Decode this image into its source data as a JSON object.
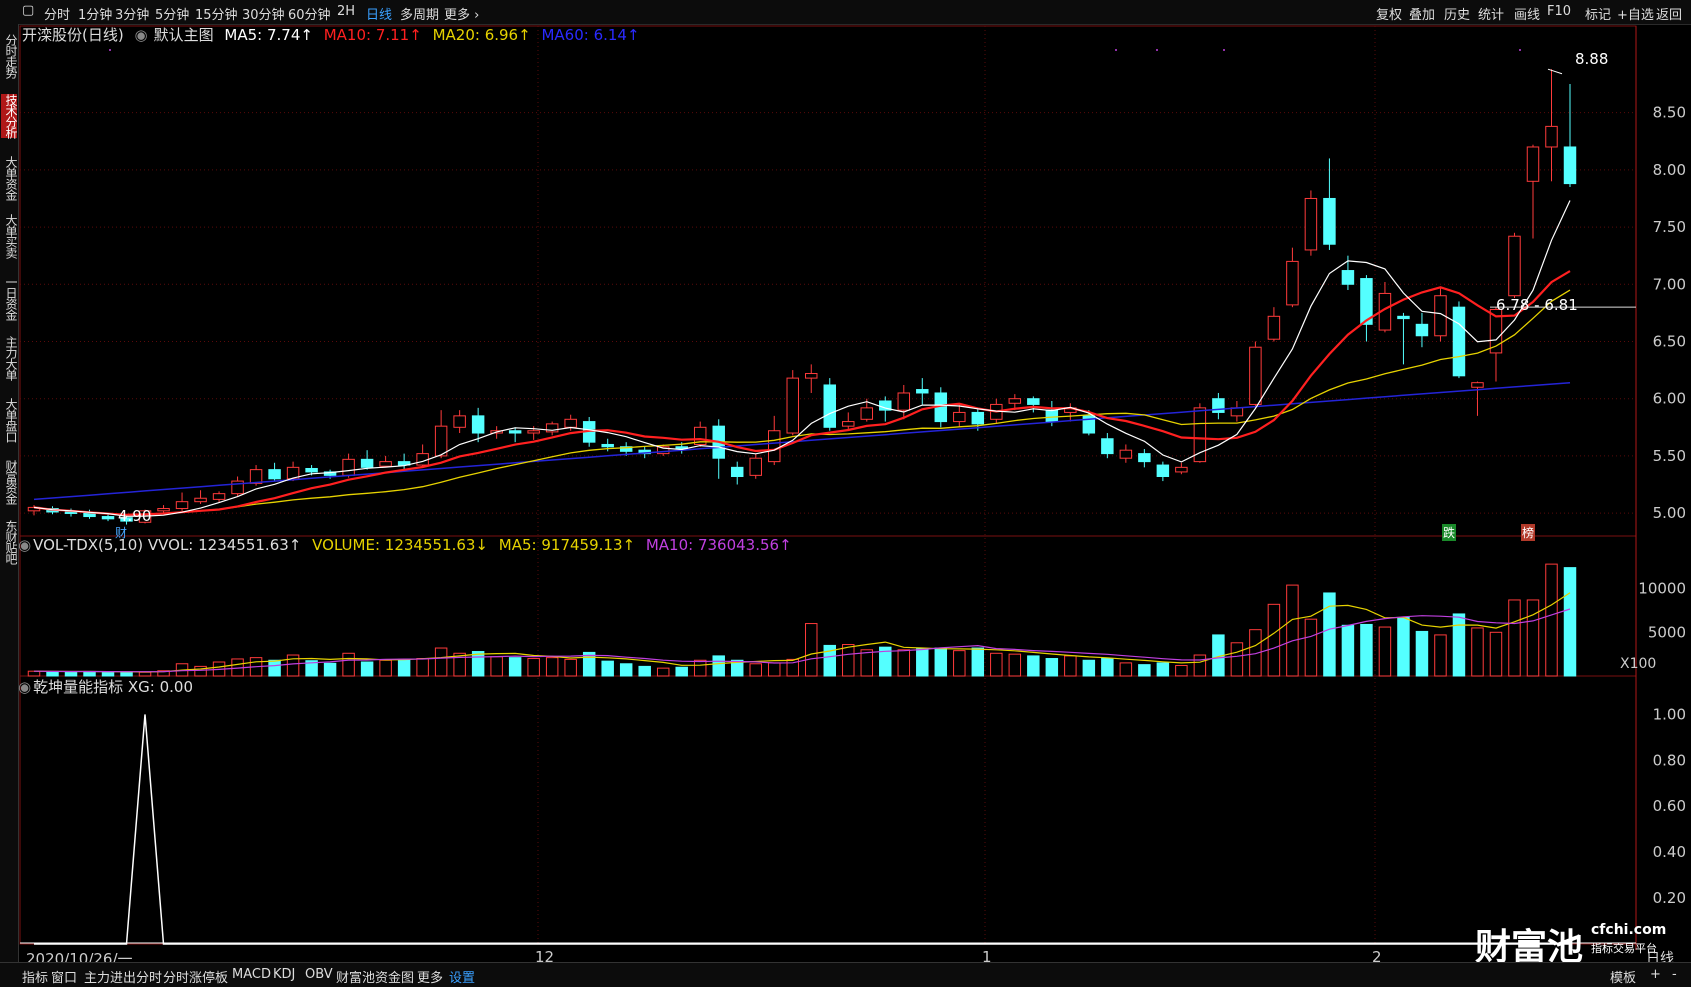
{
  "toolbar": {
    "periods": [
      "分时",
      "1分钟",
      "3分钟",
      "5分钟",
      "15分钟",
      "30分钟",
      "60分钟",
      "2H",
      "日线",
      "多周期",
      "更多"
    ],
    "active_period": "日线",
    "right_items": [
      "复权",
      "叠加",
      "历史",
      "统计",
      "画线",
      "F10",
      "标记",
      "+自选",
      "返回"
    ]
  },
  "left_nav": [
    "分时走势",
    "技术分析",
    "大单资金",
    "大单买卖",
    "一日资金",
    "主力大单",
    "大单盘口",
    "财富资金",
    "东财贴吧"
  ],
  "left_nav_active": "技术分析",
  "main_panel": {
    "stock_name": "开滦股份(日线)",
    "main_chart": "默认主图",
    "ma5": "MA5: 7.74↑",
    "ma10": "MA10: 7.11↑",
    "ma20": "MA20: 6.96↑",
    "ma60": "MA60: 6.14↑",
    "high_label": "8.88",
    "low_label": "4.90",
    "range_label": "6.78 - 6.81",
    "marker_cai": "财",
    "marker_die": "跌",
    "marker_bang": "榜"
  },
  "vol_panel": {
    "title": "VOL-TDX(5,10) VVOL: 1234551.63↑",
    "volume": "VOLUME: 1234551.63↓",
    "ma5": "MA5: 917459.13↑",
    "ma10": "MA10: 736043.56↑",
    "unit": "X100"
  },
  "ind_panel": {
    "title": "乾坤量能指标 XG: 0.00"
  },
  "x_labels": {
    "start": "2020/10/26/一",
    "m12": "12",
    "m1": "1",
    "m2": "2"
  },
  "bottom_tabs": [
    "指标",
    "窗口",
    "主力进出分时",
    "分时涨停板",
    "MACD",
    "KDJ",
    "OBV",
    "财富池资金图",
    "更多",
    "设置"
  ],
  "bottom_tabs_active": "设置",
  "bottom_right": [
    "模板",
    "+",
    "-"
  ],
  "bottom_right_label": "日线",
  "brand": {
    "name": "财富池",
    "site": "cfchi.com",
    "tagline": "指标交易平台"
  },
  "colors": {
    "up": "#ff3b3b",
    "down": "#54ffff",
    "ma5": "#ffffff",
    "ma10": "#ff2020",
    "ma20": "#e6d200",
    "ma60": "#2424d8",
    "vol_ma10": "#c040e0",
    "accent": "#3aa0ff"
  },
  "chart_data": [
    {
      "type": "candlestick",
      "title": "开滦股份(日线)",
      "ylim": [
        4.8,
        9.1
      ],
      "y_ticks": [
        5.0,
        5.5,
        6.0,
        6.5,
        7.0,
        7.5,
        8.0,
        8.5
      ],
      "x_labels": [
        "2020/10/26/一",
        "12",
        "1",
        "2"
      ],
      "candles": [
        [
          5.02,
          5.05,
          4.98,
          5.07
        ],
        [
          5.04,
          5.01,
          4.99,
          5.06
        ],
        [
          5.01,
          5.0,
          4.97,
          5.04
        ],
        [
          5.0,
          4.97,
          4.95,
          5.03
        ],
        [
          4.97,
          4.95,
          4.93,
          5.0
        ],
        [
          4.96,
          4.93,
          4.9,
          4.98
        ],
        [
          4.92,
          5.02,
          4.91,
          5.03
        ],
        [
          5.02,
          5.04,
          5.0,
          5.07
        ],
        [
          5.04,
          5.1,
          5.02,
          5.18
        ],
        [
          5.1,
          5.13,
          5.08,
          5.2
        ],
        [
          5.12,
          5.17,
          5.09,
          5.19
        ],
        [
          5.17,
          5.28,
          5.15,
          5.32
        ],
        [
          5.26,
          5.38,
          5.24,
          5.42
        ],
        [
          5.38,
          5.3,
          5.28,
          5.44
        ],
        [
          5.3,
          5.4,
          5.28,
          5.45
        ],
        [
          5.39,
          5.36,
          5.33,
          5.42
        ],
        [
          5.36,
          5.33,
          5.3,
          5.38
        ],
        [
          5.33,
          5.47,
          5.31,
          5.52
        ],
        [
          5.47,
          5.4,
          5.38,
          5.55
        ],
        [
          5.41,
          5.45,
          5.4,
          5.5
        ],
        [
          5.45,
          5.42,
          5.38,
          5.52
        ],
        [
          5.42,
          5.52,
          5.4,
          5.6
        ],
        [
          5.5,
          5.76,
          5.48,
          5.9
        ],
        [
          5.75,
          5.85,
          5.7,
          5.9
        ],
        [
          5.85,
          5.7,
          5.62,
          5.92
        ],
        [
          5.7,
          5.72,
          5.65,
          5.76
        ],
        [
          5.72,
          5.7,
          5.62,
          5.75
        ],
        [
          5.7,
          5.72,
          5.64,
          5.76
        ],
        [
          5.71,
          5.78,
          5.68,
          5.8
        ],
        [
          5.75,
          5.82,
          5.72,
          5.86
        ],
        [
          5.8,
          5.62,
          5.58,
          5.84
        ],
        [
          5.6,
          5.58,
          5.54,
          5.65
        ],
        [
          5.58,
          5.54,
          5.5,
          5.62
        ],
        [
          5.55,
          5.52,
          5.48,
          5.58
        ],
        [
          5.52,
          5.58,
          5.5,
          5.6
        ],
        [
          5.58,
          5.56,
          5.52,
          5.62
        ],
        [
          5.6,
          5.75,
          5.58,
          5.8
        ],
        [
          5.76,
          5.48,
          5.3,
          5.82
        ],
        [
          5.4,
          5.32,
          5.25,
          5.45
        ],
        [
          5.33,
          5.48,
          5.3,
          5.52
        ],
        [
          5.45,
          5.72,
          5.42,
          5.85
        ],
        [
          5.7,
          6.18,
          5.68,
          6.25
        ],
        [
          6.18,
          6.22,
          6.05,
          6.3
        ],
        [
          6.12,
          5.75,
          5.72,
          6.18
        ],
        [
          5.76,
          5.8,
          5.72,
          5.88
        ],
        [
          5.82,
          5.92,
          5.8,
          6.0
        ],
        [
          5.98,
          5.9,
          5.8,
          6.02
        ],
        [
          5.9,
          6.05,
          5.82,
          6.12
        ],
        [
          6.08,
          6.05,
          5.95,
          6.18
        ],
        [
          6.05,
          5.8,
          5.75,
          6.1
        ],
        [
          5.8,
          5.88,
          5.75,
          5.95
        ],
        [
          5.88,
          5.78,
          5.72,
          5.92
        ],
        [
          5.82,
          5.95,
          5.78,
          6.0
        ],
        [
          5.96,
          6.0,
          5.9,
          6.04
        ],
        [
          6.0,
          5.95,
          5.88,
          6.02
        ],
        [
          5.9,
          5.8,
          5.76,
          5.98
        ],
        [
          5.88,
          5.92,
          5.8,
          5.96
        ],
        [
          5.85,
          5.7,
          5.68,
          5.9
        ],
        [
          5.65,
          5.52,
          5.48,
          5.7
        ],
        [
          5.48,
          5.55,
          5.44,
          5.6
        ],
        [
          5.52,
          5.45,
          5.4,
          5.56
        ],
        [
          5.42,
          5.32,
          5.28,
          5.45
        ],
        [
          5.36,
          5.4,
          5.34,
          5.44
        ],
        [
          5.45,
          5.92,
          5.44,
          5.96
        ],
        [
          6.0,
          5.88,
          5.82,
          6.05
        ],
        [
          5.85,
          5.92,
          5.8,
          5.98
        ],
        [
          5.95,
          6.45,
          5.92,
          6.5
        ],
        [
          6.52,
          6.72,
          6.5,
          6.8
        ],
        [
          6.82,
          7.2,
          6.8,
          7.32
        ],
        [
          7.3,
          7.75,
          7.25,
          7.82
        ],
        [
          7.75,
          7.35,
          7.3,
          8.1
        ],
        [
          7.12,
          7.0,
          6.95,
          7.25
        ],
        [
          7.05,
          6.65,
          6.5,
          7.08
        ],
        [
          6.6,
          6.92,
          6.58,
          7.02
        ],
        [
          6.72,
          6.7,
          6.3,
          6.75
        ],
        [
          6.65,
          6.55,
          6.45,
          6.75
        ],
        [
          6.55,
          6.9,
          6.5,
          6.98
        ],
        [
          6.8,
          6.2,
          6.18,
          6.85
        ],
        [
          6.1,
          6.14,
          5.85,
          6.15
        ],
        [
          6.4,
          6.78,
          6.15,
          6.8
        ],
        [
          6.9,
          7.42,
          6.88,
          7.45
        ],
        [
          7.9,
          8.2,
          7.4,
          8.22
        ],
        [
          8.2,
          8.38,
          7.9,
          8.88
        ],
        [
          8.2,
          7.88,
          7.85,
          8.75
        ]
      ],
      "ma5_last": 7.74,
      "ma10_last": 7.11,
      "ma20_last": 6.96,
      "ma60_last": 6.14
    },
    {
      "type": "bar",
      "title": "VOL-TDX(5,10)",
      "ylabel": "X100",
      "y_ticks": [
        5000,
        10000
      ],
      "ylim": [
        0,
        13500
      ],
      "values": [
        550,
        500,
        480,
        520,
        450,
        480,
        430,
        600,
        1400,
        1100,
        1600,
        1950,
        2100,
        1800,
        2400,
        1750,
        1450,
        2600,
        1600,
        1800,
        1900,
        2000,
        3200,
        2600,
        2800,
        2200,
        2100,
        2000,
        2100,
        1900,
        2700,
        1700,
        1400,
        1100,
        900,
        1000,
        1800,
        2300,
        1800,
        1400,
        1500,
        1900,
        6000,
        3500,
        3600,
        3000,
        3300,
        3000,
        3100,
        3200,
        2900,
        3200,
        2600,
        2500,
        2300,
        2000,
        2300,
        1800,
        2000,
        1500,
        1300,
        1500,
        1200,
        2400,
        4700,
        3800,
        5300,
        8200,
        10400,
        6500,
        9500,
        5800,
        5900,
        5600,
        6700,
        5100,
        4700,
        7100,
        5500,
        5000,
        8700,
        8700,
        12800,
        12400
      ],
      "ma5_last": 917459.13,
      "ma10_last": 736043.56
    },
    {
      "type": "line",
      "title": "乾坤量能指标",
      "ylim": [
        0,
        1.08
      ],
      "y_ticks": [
        0.2,
        0.4,
        0.6,
        0.8,
        1.0
      ],
      "values": [
        0,
        0,
        0,
        0,
        0,
        0,
        1,
        0,
        0,
        0,
        0,
        0,
        0,
        0,
        0,
        0,
        0,
        0,
        0,
        0,
        0,
        0,
        0,
        0,
        0,
        0,
        0,
        0,
        0,
        0,
        0,
        0,
        0,
        0,
        0,
        0,
        0,
        0,
        0,
        0,
        0,
        0,
        0,
        0,
        0,
        0,
        0,
        0,
        0,
        0,
        0,
        0,
        0,
        0,
        0,
        0,
        0,
        0,
        0,
        0,
        0,
        0,
        0,
        0,
        0,
        0,
        0,
        0,
        0,
        0,
        0,
        0,
        0,
        0,
        0,
        0,
        0,
        0,
        0,
        0,
        0,
        0,
        0,
        0
      ]
    }
  ]
}
